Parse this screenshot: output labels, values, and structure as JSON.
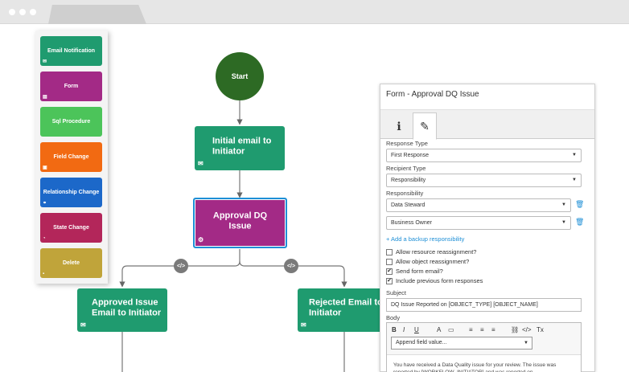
{
  "palette": {
    "items": [
      {
        "label": "Email Notification",
        "icon": "envelope-icon",
        "color": "#1f9b6f"
      },
      {
        "label": "Form",
        "icon": "form-icon",
        "color": "#a32a86"
      },
      {
        "label": "Sql Procedure",
        "icon": "",
        "color": "#4cc45a"
      },
      {
        "label": "Field Change",
        "icon": "field-icon",
        "color": "#f26a12"
      },
      {
        "label": "Relationship Change",
        "icon": "relationship-icon",
        "color": "#1c68c9"
      },
      {
        "label": "State Change",
        "icon": "state-icon",
        "color": "#b3265a"
      },
      {
        "label": "Delete",
        "icon": "trash-icon",
        "color": "#c0a43a"
      }
    ]
  },
  "canvas": {
    "start_label": "Start",
    "nodes": {
      "initial_email": "Initial email to Initiator",
      "approval": "Approval DQ Issue",
      "approved_issue": "Approved Issue Email to Initiator",
      "rejected_email": "Rejected Email to Initiator"
    },
    "decision_symbol": "</>",
    "colors": {
      "email_node": "#1f9b6f",
      "form_node": "#a32a86",
      "selected_border": "#1e8fd6",
      "start": "#2d6a24"
    }
  },
  "panel": {
    "title": "Form - Approval DQ Issue",
    "tabs": [
      {
        "icon": "info-icon",
        "glyph": "ℹ"
      },
      {
        "icon": "pencil-icon",
        "glyph": "✎"
      }
    ],
    "response_type_label": "Response Type",
    "response_type_value": "First Response",
    "recipient_type_label": "Recipient Type",
    "recipient_type_value": "Responsibility",
    "responsibility_label": "Responsibility",
    "responsibility_values": [
      "Data Steward",
      "Business Owner"
    ],
    "add_backup_link": "+ Add a backup responsibility",
    "checkboxes": [
      {
        "label": "Allow resource reassignment?",
        "checked": false
      },
      {
        "label": "Allow object reassignment?",
        "checked": false
      },
      {
        "label": "Send form email?",
        "checked": true
      },
      {
        "label": "Include previous form responses",
        "checked": true
      }
    ],
    "subject_label": "Subject",
    "subject_value": "DQ Issue Reported on [OBJECT_TYPE] [OBJECT_NAME]",
    "body_label": "Body",
    "toolbar": [
      "B",
      "I",
      "U",
      "A",
      "▭",
      "≡",
      "≡",
      "≡",
      "⛓",
      "</>",
      "Tx"
    ],
    "append_placeholder": "Append field value...",
    "body_text": "You have received a Data Quality issue for your review. The issue was reported by [WORKFLOW_INITIATOR] and was reported on"
  }
}
